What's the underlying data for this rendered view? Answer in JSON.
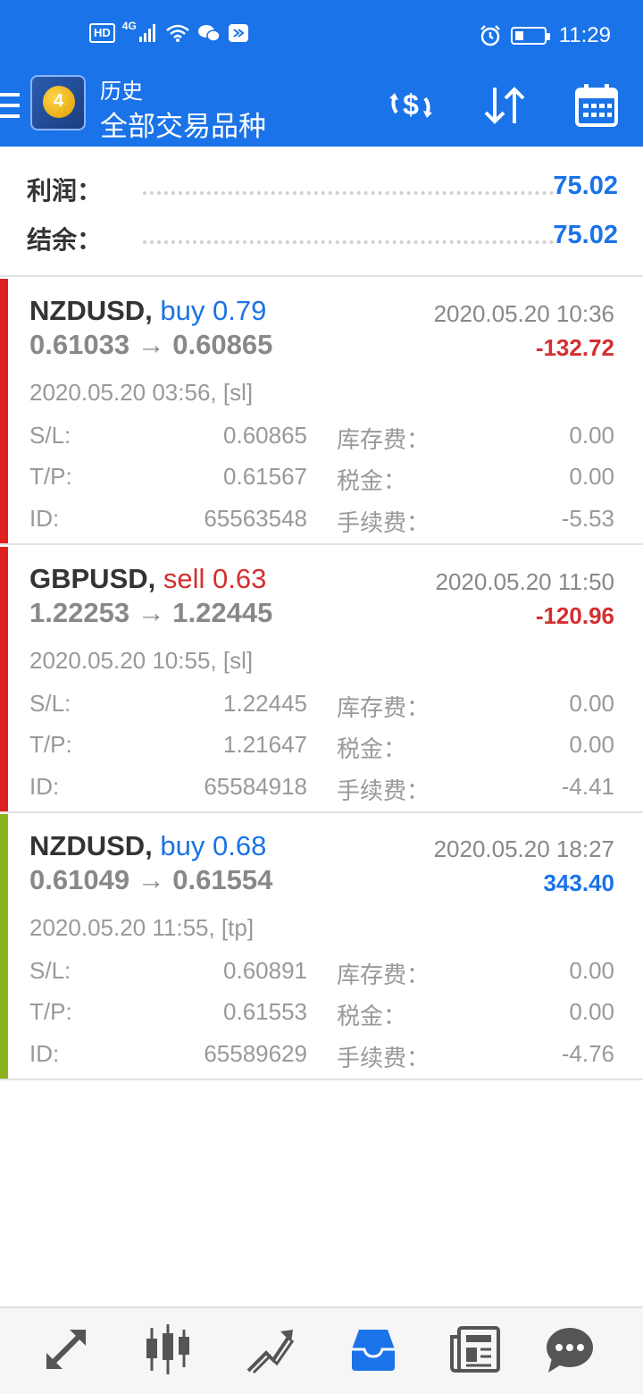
{
  "status": {
    "hd": "HD",
    "net": "4G",
    "time": "11:29"
  },
  "header": {
    "title_small": "历史",
    "title_big": "全部交易品种"
  },
  "summary": {
    "profit_label": "利润：",
    "profit_value": "75.02",
    "balance_label": "结余：",
    "balance_value": "75.02"
  },
  "colors": {
    "accent": "#1a73e8",
    "loss": "#d32f2f",
    "gain": "#1a73e8",
    "loss_bar": "#e02020",
    "gain_bar": "#8bb31d"
  },
  "deals": [
    {
      "symbol": "NZDUSD,",
      "direction": "buy 0.79",
      "close_time": "2020.05.20 10:36",
      "prices": "0.61033 → 0.60865",
      "profit": "-132.72",
      "open_info": "2020.05.20 03:56, [sl]",
      "sl_label": "S/L:",
      "sl_value": "0.60865",
      "tp_label": "T/P:",
      "tp_value": "0.61567",
      "id_label": "ID:",
      "id_value": "65563548",
      "swap_label": "库存费：",
      "swap_value": "0.00",
      "tax_label": "税金：",
      "tax_value": "0.00",
      "fee_label": "手续费：",
      "fee_value": "-5.53"
    },
    {
      "symbol": "GBPUSD,",
      "direction": "sell 0.63",
      "close_time": "2020.05.20 11:50",
      "prices": "1.22253 → 1.22445",
      "profit": "-120.96",
      "open_info": "2020.05.20 10:55, [sl]",
      "sl_label": "S/L:",
      "sl_value": "1.22445",
      "tp_label": "T/P:",
      "tp_value": "1.21647",
      "id_label": "ID:",
      "id_value": "65584918",
      "swap_label": "库存费：",
      "swap_value": "0.00",
      "tax_label": "税金：",
      "tax_value": "0.00",
      "fee_label": "手续费：",
      "fee_value": "-4.41"
    },
    {
      "symbol": "NZDUSD,",
      "direction": "buy 0.68",
      "close_time": "2020.05.20 18:27",
      "prices": "0.61049 → 0.61554",
      "profit": "343.40",
      "open_info": "2020.05.20 11:55, [tp]",
      "sl_label": "S/L:",
      "sl_value": "0.60891",
      "tp_label": "T/P:",
      "tp_value": "0.61553",
      "id_label": "ID:",
      "id_value": "65589629",
      "swap_label": "库存费：",
      "swap_value": "0.00",
      "tax_label": "税金：",
      "tax_value": "0.00",
      "fee_label": "手续费：",
      "fee_value": "-4.76"
    }
  ]
}
